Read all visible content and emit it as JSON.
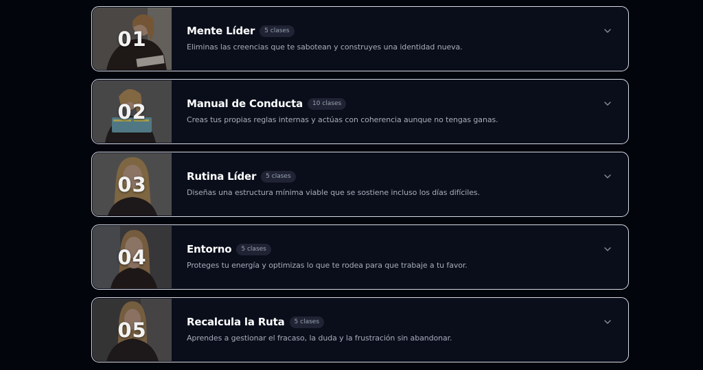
{
  "modules": [
    {
      "number": "01",
      "title": "Mente Líder",
      "badge": "5 clases",
      "description": "Eliminas las creencias que te sabotean y construyes una identidad nueva.",
      "icon": "chevron-down-icon"
    },
    {
      "number": "02",
      "title": "Manual de Conducta",
      "badge": "10 clases",
      "description": "Creas tus propias reglas internas y actúas con coherencia aunque no tengas ganas.",
      "icon": "chevron-down-icon"
    },
    {
      "number": "03",
      "title": "Rutina Líder",
      "badge": "5 clases",
      "description": "Diseñas una estructura mínima viable que se sostiene incluso los días difíciles.",
      "icon": "chevron-down-icon"
    },
    {
      "number": "04",
      "title": "Entorno",
      "badge": "5 clases",
      "description": "Proteges tu energía y optimizas lo que te rodea para que trabaje a tu favor.",
      "icon": "chevron-down-icon"
    },
    {
      "number": "05",
      "title": "Recalcula la Ruta",
      "badge": "5 clases",
      "description": "Aprendes a gestionar el fracaso, la duda y la frustración sin abandonar.",
      "icon": "chevron-down-icon"
    }
  ],
  "colors": {
    "page_background": "#03050d",
    "card_background": "#0a0e1b",
    "card_border": "#d9dce3",
    "badge_background": "#1f2333",
    "badge_text": "#9ca3b4",
    "description_text": "#a8adbb"
  }
}
